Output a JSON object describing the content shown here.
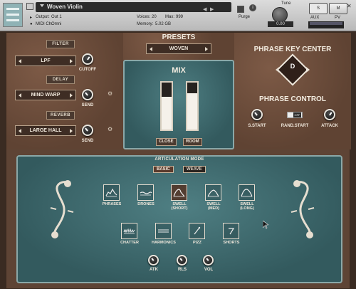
{
  "header": {
    "instrument_name": "Woven Violin",
    "output_label": "Output:",
    "output_value": "Out 1",
    "midi_label": "MIDI Ch:",
    "midi_value": "Omni",
    "voices_label": "Voices:",
    "voices_value": "20",
    "max_label": "Max:",
    "max_value": "999",
    "memory_label": "Memory:",
    "memory_value": "5.02 GB",
    "purge_label": "Purge",
    "tune_label": "Tune",
    "tune_value": "0.00",
    "s_label": "S",
    "m_label": "M",
    "aux_label": "AUX",
    "pv_label": "PV",
    "camera_icon": "camera-icon",
    "info_icon": "info-icon"
  },
  "effects": {
    "filter_title": "FILTER",
    "filter_type": "LPF",
    "cutoff_label": "CUTOFF",
    "delay_title": "DELAY",
    "delay_type": "MIND WARP",
    "delay_send_label": "SEND",
    "reverb_title": "REVERB",
    "reverb_type": "LARGE HALL",
    "reverb_send_label": "SEND"
  },
  "presets": {
    "title": "PRESETS",
    "current": "WOVEN"
  },
  "mix": {
    "title": "MIX",
    "close_label": "CLOSE",
    "close_level": 0.7,
    "room_label": "ROOM",
    "room_level": 0.78
  },
  "phrase": {
    "key_center_title": "PHRASE KEY CENTER",
    "key": "D",
    "control_title": "PHRASE CONTROL",
    "sstart_label": "S.START",
    "randstart_label": "RAND.START",
    "randstart_state": "OFF",
    "attack_label": "ATTACK"
  },
  "articulation": {
    "title": "ARTICULATION MODE",
    "modes": [
      "BASIC",
      "WEAVE"
    ],
    "selected_mode": "BASIC",
    "row1": [
      {
        "label": "PHRASES",
        "active": false
      },
      {
        "label": "DRONES",
        "active": false
      },
      {
        "label": "SWELL\n(SHORT)",
        "active": true
      },
      {
        "label": "SWELL\n(MED)",
        "active": false
      },
      {
        "label": "SWELL\n(LONG)",
        "active": false
      }
    ],
    "row2": [
      {
        "label": "CHATTER",
        "active": false
      },
      {
        "label": "HARMONICS",
        "active": false
      },
      {
        "label": "PIZZ",
        "active": false
      },
      {
        "label": "SHORTS",
        "active": false
      }
    ],
    "atk_label": "ATK",
    "rls_label": "RLS",
    "vol_label": "VOL"
  },
  "colors": {
    "leather": "#6b4c3b",
    "teal": "#3f6b6f",
    "accent_cream": "#f0e8dc"
  }
}
